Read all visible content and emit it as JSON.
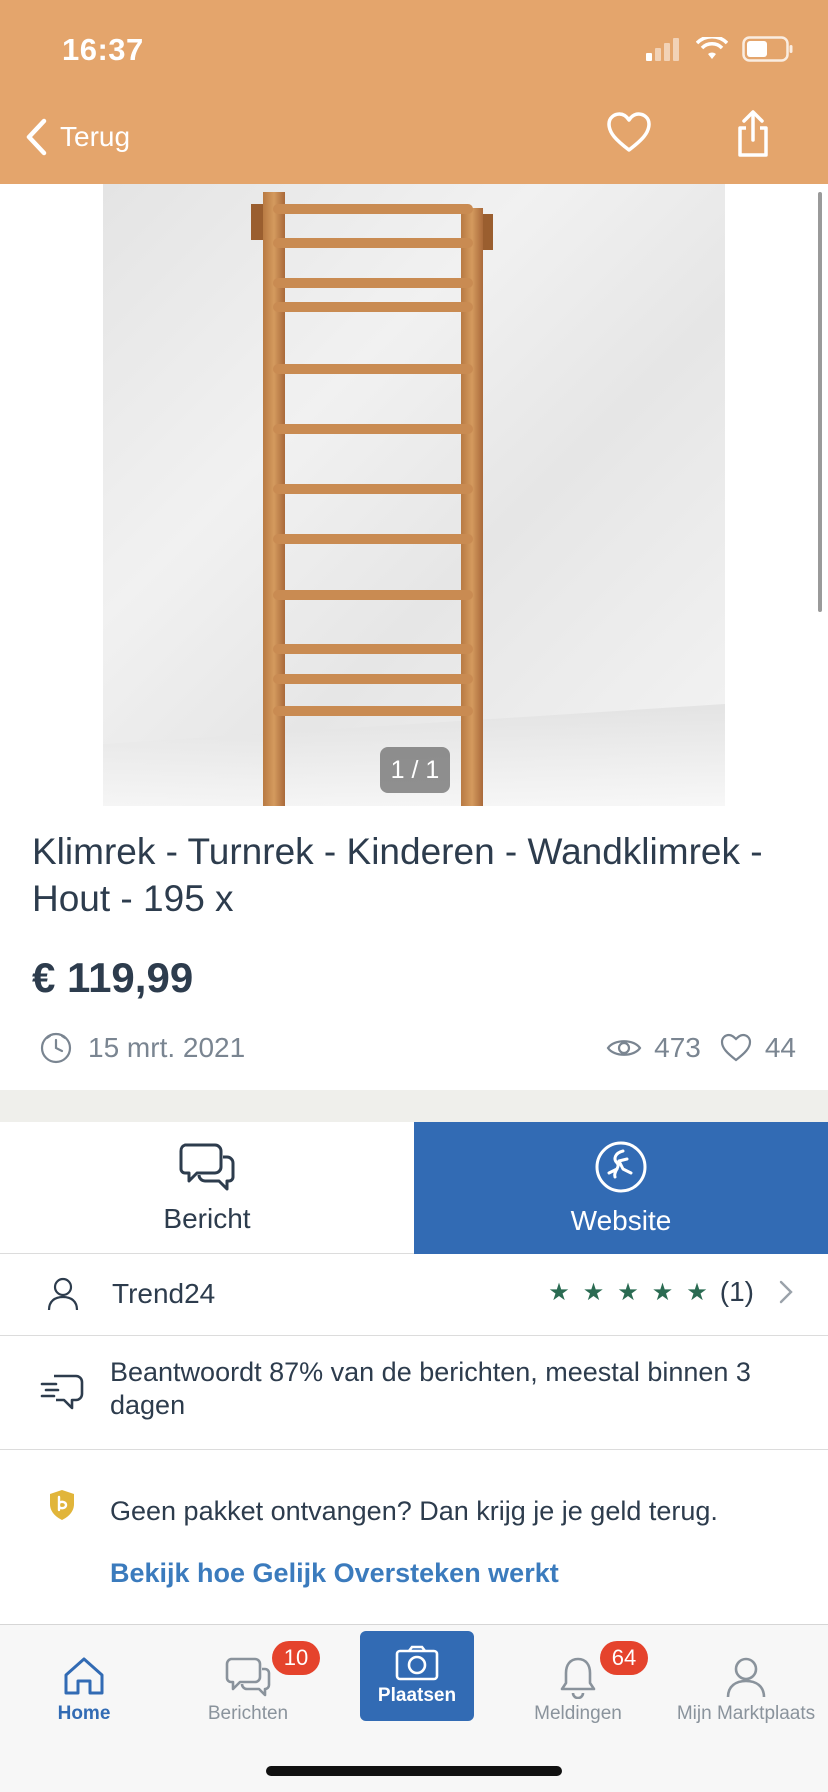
{
  "status_bar": {
    "time": "16:37"
  },
  "nav": {
    "back_label": "Terug",
    "icons": [
      "chevron-left-icon",
      "heart-icon",
      "share-icon"
    ]
  },
  "gallery": {
    "counter": "1 / 1",
    "image": "wall-bars-photo"
  },
  "listing": {
    "title": "Klimrek - Turnrek - Kinderen - Wandklimrek - Hout  - 195 x",
    "price": "€ 119,99",
    "date": "15 mrt. 2021",
    "views": "473",
    "favorites": "44"
  },
  "actions": {
    "message_label": "Bericht",
    "website_label": "Website"
  },
  "seller": {
    "name": "Trend24",
    "rating_count": "(1)",
    "stars": 5
  },
  "response": {
    "text": "Beantwoordt 87% van de berichten, meestal binnen 3 dagen"
  },
  "guarantee": {
    "text": "Geen pakket ontvangen? Dan krijg je je geld terug.",
    "link": "Bekijk hoe Gelijk Oversteken werkt"
  },
  "tabbar": {
    "home": "Home",
    "messages": "Berichten",
    "messages_badge": "10",
    "place": "Plaatsen",
    "notifications": "Meldingen",
    "notifications_badge": "64",
    "mine": "Mijn Marktplaats"
  },
  "colors": {
    "header": "#e4a56c",
    "primary": "#326bb4",
    "badge": "#e5432c",
    "star": "#2a6b52",
    "link": "#3b7bbd"
  }
}
